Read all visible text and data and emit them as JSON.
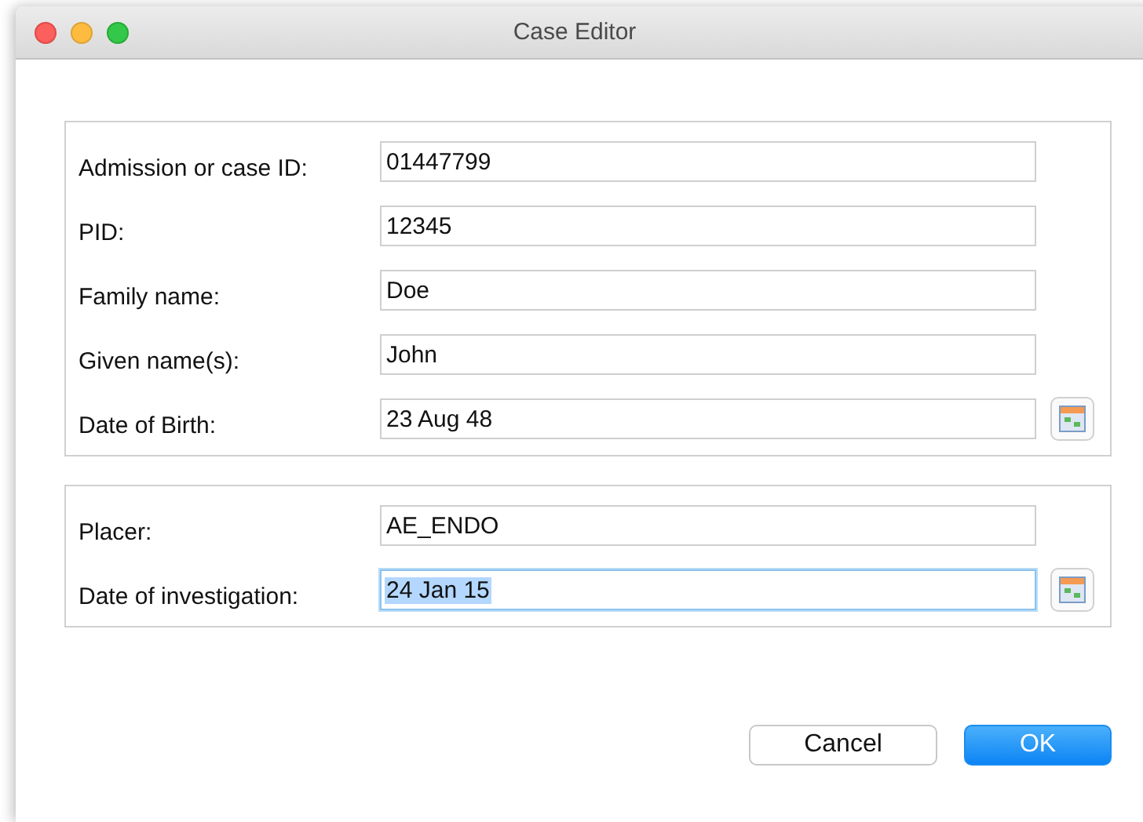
{
  "window": {
    "title": "Case Editor"
  },
  "groups": [
    {
      "fields": [
        {
          "label": "Admission or case ID:",
          "value": "01447799",
          "kind": "text",
          "focused": false
        },
        {
          "label": "PID:",
          "value": "12345",
          "kind": "text",
          "focused": false
        },
        {
          "label": "Family name:",
          "value": "Doe",
          "kind": "text",
          "focused": false
        },
        {
          "label": "Given name(s):",
          "value": "John",
          "kind": "text",
          "focused": false
        },
        {
          "label": "Date of Birth:",
          "value": "23 Aug 48",
          "kind": "date",
          "focused": false
        }
      ]
    },
    {
      "fields": [
        {
          "label": "Placer:",
          "value": "AE_ENDO",
          "kind": "text",
          "focused": false
        },
        {
          "label": "Date of investigation:",
          "value": "24 Jan 15",
          "kind": "date",
          "focused": true
        }
      ]
    }
  ],
  "buttons": [
    {
      "label": "Cancel",
      "default": false
    },
    {
      "label": "OK",
      "default": true
    }
  ]
}
